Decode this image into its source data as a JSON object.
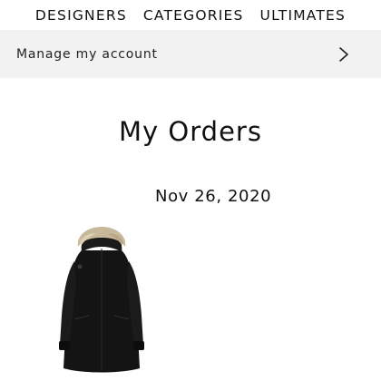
{
  "nav": {
    "items": [
      "DESIGNERS",
      "CATEGORIES",
      "ULTIMATES"
    ]
  },
  "account": {
    "label": "Manage my account",
    "icon": "chevron-right-icon"
  },
  "page": {
    "title": "My Orders"
  },
  "order": {
    "date": "Nov 26, 2020",
    "product_image": "black-parka-with-fur-hood"
  }
}
